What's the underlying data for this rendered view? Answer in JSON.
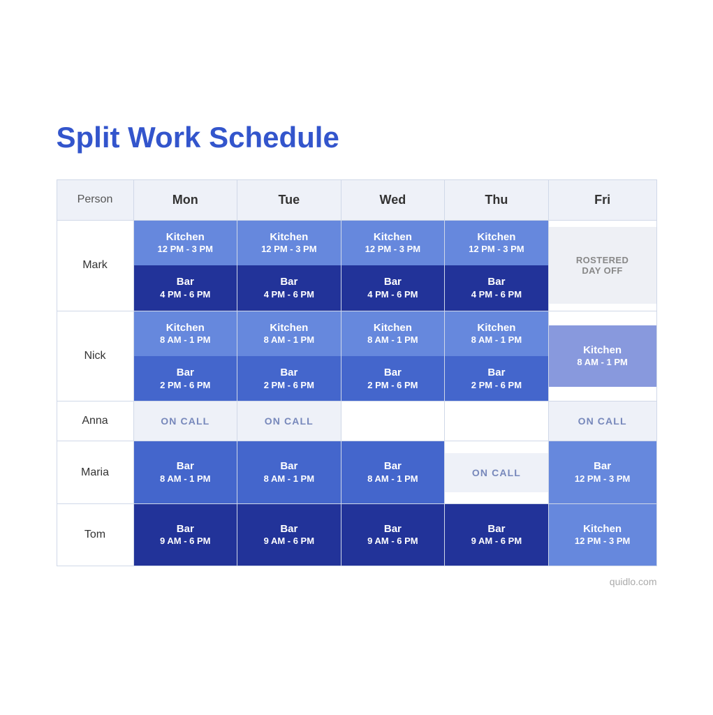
{
  "title": "Split Work Schedule",
  "footer": "quidlo.com",
  "columns": [
    "Person",
    "Mon",
    "Tue",
    "Wed",
    "Thu",
    "Fri"
  ],
  "rows": [
    {
      "person": "Mark",
      "days": [
        {
          "top": {
            "location": "Kitchen",
            "time": "12 PM - 3 PM",
            "color": "blue-light"
          },
          "bottom": {
            "location": "Bar",
            "time": "4 PM  - 6 PM",
            "color": "blue-dark"
          }
        },
        {
          "top": {
            "location": "Kitchen",
            "time": "12 PM - 3 PM",
            "color": "blue-light"
          },
          "bottom": {
            "location": "Bar",
            "time": "4 PM  - 6 PM",
            "color": "blue-dark"
          }
        },
        {
          "top": {
            "location": "Kitchen",
            "time": "12 PM - 3 PM",
            "color": "blue-light"
          },
          "bottom": {
            "location": "Bar",
            "time": "4 PM  - 6 PM",
            "color": "blue-dark"
          }
        },
        {
          "top": {
            "location": "Kitchen",
            "time": "12 PM - 3 PM",
            "color": "blue-light"
          },
          "bottom": {
            "location": "Bar",
            "time": "4 PM  - 6 PM",
            "color": "blue-dark"
          }
        },
        {
          "type": "rostered",
          "text": "ROSTERED\nDAY OFF"
        }
      ]
    },
    {
      "person": "Nick",
      "days": [
        {
          "top": {
            "location": "Kitchen",
            "time": "8 AM - 1 PM",
            "color": "blue-light"
          },
          "bottom": {
            "location": "Bar",
            "time": "2 PM  - 6 PM",
            "color": "blue-med"
          }
        },
        {
          "top": {
            "location": "Kitchen",
            "time": "8 AM - 1 PM",
            "color": "blue-light"
          },
          "bottom": {
            "location": "Bar",
            "time": "2 PM  - 6 PM",
            "color": "blue-med"
          }
        },
        {
          "top": {
            "location": "Kitchen",
            "time": "8 AM - 1 PM",
            "color": "blue-light"
          },
          "bottom": {
            "location": "Bar",
            "time": "2 PM  - 6 PM",
            "color": "blue-med"
          }
        },
        {
          "top": {
            "location": "Kitchen",
            "time": "8 AM - 1 PM",
            "color": "blue-light"
          },
          "bottom": {
            "location": "Bar",
            "time": "2 PM  - 6 PM",
            "color": "blue-med"
          }
        },
        {
          "type": "single",
          "location": "Kitchen",
          "time": "8 AM - 1 PM",
          "color": "blue-pale"
        }
      ]
    },
    {
      "person": "Anna",
      "days": [
        {
          "type": "oncall",
          "text": "ON CALL"
        },
        {
          "type": "oncall",
          "text": "ON CALL"
        },
        {
          "type": "empty"
        },
        {
          "type": "empty"
        },
        {
          "type": "oncall",
          "text": "ON CALL"
        }
      ]
    },
    {
      "person": "Maria",
      "days": [
        {
          "type": "single",
          "location": "Bar",
          "time": "8 AM  - 1 PM",
          "color": "blue-med"
        },
        {
          "type": "single",
          "location": "Bar",
          "time": "8 AM  - 1 PM",
          "color": "blue-med"
        },
        {
          "type": "single",
          "location": "Bar",
          "time": "8 AM  - 1 PM",
          "color": "blue-med"
        },
        {
          "type": "oncall",
          "text": "ON CALL"
        },
        {
          "type": "single",
          "location": "Bar",
          "time": "12 PM - 3 PM",
          "color": "blue-light"
        }
      ]
    },
    {
      "person": "Tom",
      "days": [
        {
          "type": "single",
          "location": "Bar",
          "time": "9 AM  - 6 PM",
          "color": "blue-dark"
        },
        {
          "type": "single",
          "location": "Bar",
          "time": "9 AM  - 6 PM",
          "color": "blue-dark"
        },
        {
          "type": "single",
          "location": "Bar",
          "time": "9 AM  - 6 PM",
          "color": "blue-dark"
        },
        {
          "type": "single",
          "location": "Bar",
          "time": "9 AM  - 6 PM",
          "color": "blue-dark"
        },
        {
          "type": "single",
          "location": "Kitchen",
          "time": "12 PM  - 3 PM",
          "color": "blue-light"
        }
      ]
    }
  ]
}
